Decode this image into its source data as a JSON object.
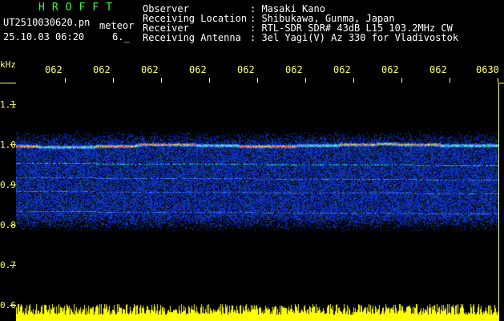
{
  "header": {
    "logo": "HROFFT",
    "filename": "UT2510030620.pn",
    "mode": "meteor",
    "datetime": "25.10.03 06:20",
    "extra": "6._"
  },
  "station": {
    "labels": [
      "Observer",
      "Receiving Location",
      "Receiver",
      "Receiving Antenna"
    ],
    "values": [
      ": Masaki Kano",
      ": Shibukawa, Gunma, Japan",
      ": RTL-SDR SDR# 43dB L15 103.2MHz CW",
      ": 3el Yagi(V) Az 330 for Vladivostok"
    ]
  },
  "axes": {
    "unit": "kHz",
    "time_ticks": [
      "062",
      "062",
      "062",
      "062",
      "062",
      "062",
      "062",
      "062",
      "062",
      "0630"
    ],
    "freq_ticks": [
      "1.1",
      "1.0",
      "0.9",
      "0.8",
      "0.7",
      "0.6"
    ]
  },
  "colors": {
    "background": "#000000",
    "text_header": "#ffffff",
    "text_axis": "#ffff66",
    "logo": "#33ff33",
    "signal_low": "#0a1a8c",
    "signal_mid": "#2ee6c8",
    "signal_high": "#ff3333",
    "noise_floor": "#ffff00"
  }
}
